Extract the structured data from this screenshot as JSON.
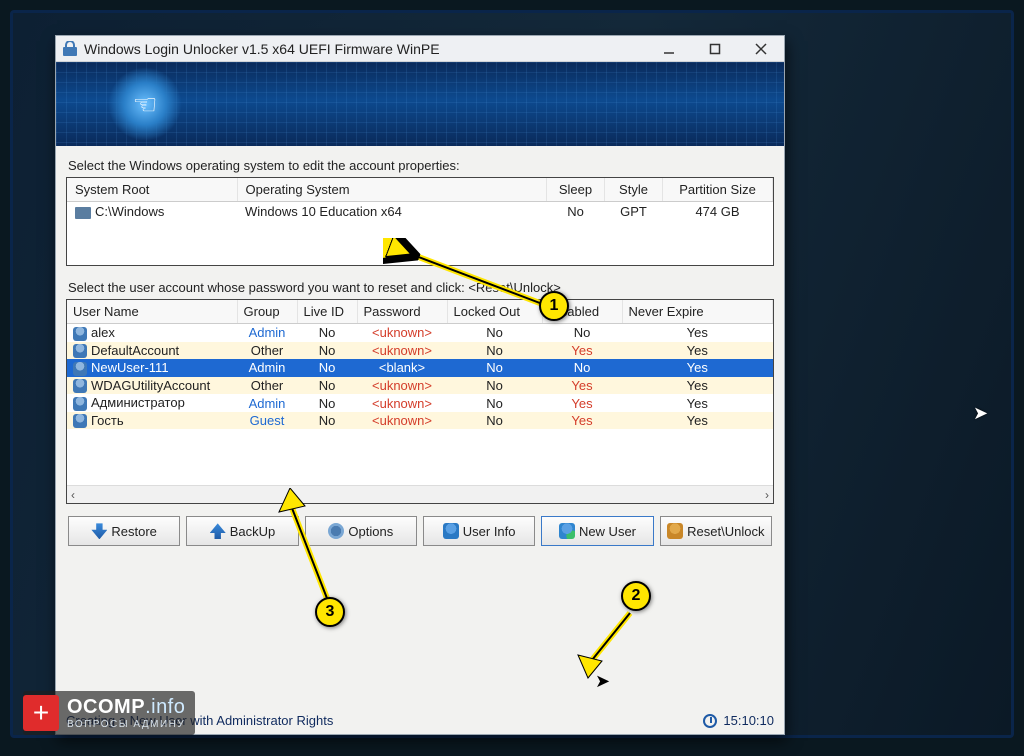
{
  "window": {
    "title": "Windows Login Unlocker v1.5 x64  UEFI Firmware WinPE"
  },
  "labels": {
    "os_select": "Select the Windows operating system to edit the account properties:",
    "user_select": "Select the user account whose password you want to reset and click: <Reset\\Unlock>"
  },
  "os_table": {
    "headers": {
      "system_root": "System Root",
      "operating_system": "Operating System",
      "sleep": "Sleep",
      "style": "Style",
      "partition_size": "Partition Size"
    },
    "rows": [
      {
        "system_root": "C:\\Windows",
        "operating_system": "Windows 10 Education x64",
        "sleep": "No",
        "style": "GPT",
        "partition_size": "474 GB"
      }
    ]
  },
  "user_table": {
    "headers": {
      "user_name": "User Name",
      "group": "Group",
      "live_id": "Live ID",
      "password": "Password",
      "locked_out": "Locked Out",
      "disabled": "Disabled",
      "never_expire": "Never Expire"
    },
    "rows": [
      {
        "user_name": "alex",
        "group": "Admin",
        "live_id": "No",
        "password": "<uknown>",
        "locked_out": "No",
        "disabled": "No",
        "never_expire": "Yes",
        "selected": false,
        "alt": false
      },
      {
        "user_name": "DefaultAccount",
        "group": "Other",
        "live_id": "No",
        "password": "<uknown>",
        "locked_out": "No",
        "disabled": "Yes",
        "never_expire": "Yes",
        "selected": false,
        "alt": true
      },
      {
        "user_name": "NewUser-111",
        "group": "Admin",
        "live_id": "No",
        "password": "<blank>",
        "locked_out": "No",
        "disabled": "No",
        "never_expire": "Yes",
        "selected": true,
        "alt": false
      },
      {
        "user_name": "WDAGUtilityAccount",
        "group": "Other",
        "live_id": "No",
        "password": "<uknown>",
        "locked_out": "No",
        "disabled": "Yes",
        "never_expire": "Yes",
        "selected": false,
        "alt": true
      },
      {
        "user_name": "Администратор",
        "group": "Admin",
        "live_id": "No",
        "password": "<uknown>",
        "locked_out": "No",
        "disabled": "Yes",
        "never_expire": "Yes",
        "selected": false,
        "alt": false
      },
      {
        "user_name": "Гость",
        "group": "Guest",
        "live_id": "No",
        "password": "<uknown>",
        "locked_out": "No",
        "disabled": "Yes",
        "never_expire": "Yes",
        "selected": false,
        "alt": true
      }
    ]
  },
  "buttons": {
    "restore": "Restore",
    "backup": "BackUp",
    "options": "Options",
    "user_info": "User Info",
    "new_user": "New User",
    "reset_unlock": "Reset\\Unlock"
  },
  "status": {
    "text": "Creating a New User with Administrator Rights",
    "time": "15:10:10"
  },
  "callouts": {
    "c1": "1",
    "c2": "2",
    "c3": "3"
  },
  "watermark": {
    "brand_main": "OCOMP",
    "brand_suffix": ".info",
    "sub": "ВОПРОСЫ АДМИНУ"
  },
  "scroll": {
    "left": "‹",
    "right": "›"
  }
}
